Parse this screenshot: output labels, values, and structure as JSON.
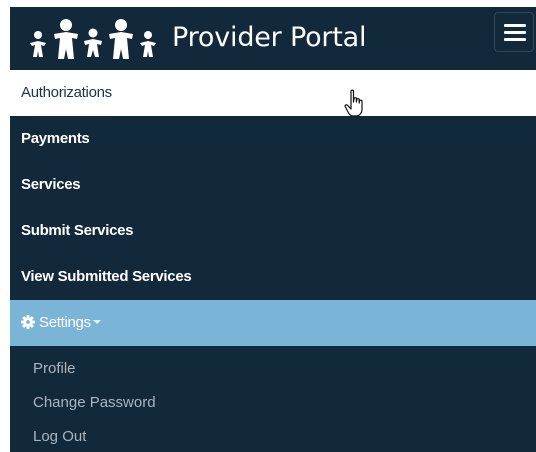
{
  "header": {
    "brand": "Provider Portal",
    "logo_icon": "family-figures-logo",
    "menu_icon": "hamburger-menu-icon"
  },
  "menu": {
    "items": [
      {
        "label": "Authorizations",
        "active": true
      },
      {
        "label": "Payments"
      },
      {
        "label": "Services"
      },
      {
        "label": "Submit Services"
      },
      {
        "label": "View Submitted Services"
      }
    ],
    "settings": {
      "label": "Settings",
      "icon": "gear-icon",
      "submenu": [
        {
          "label": "Profile"
        },
        {
          "label": "Change Password"
        },
        {
          "label": "Log Out"
        }
      ]
    }
  },
  "colors": {
    "nav_background": "#11293a",
    "active_item_background": "#ffffff",
    "settings_background": "#7ab4d6",
    "submenu_text": "#aab5bf"
  },
  "cursor": "hand-pointer-cursor"
}
